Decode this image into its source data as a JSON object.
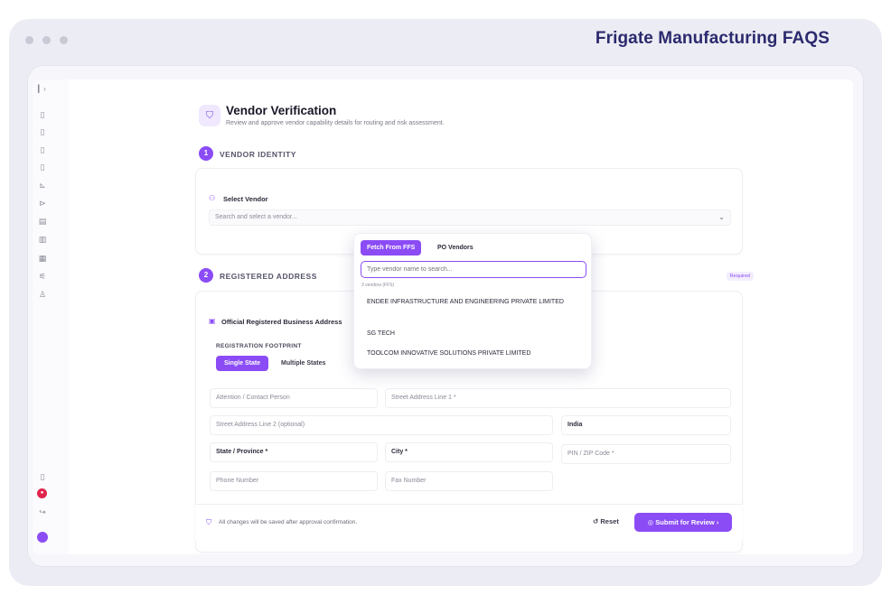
{
  "browser": {
    "brand_title": "Frigate Manufacturing FAQS"
  },
  "header": {
    "title": "Vendor Verification",
    "subtitle": "Review and approve vendor capability details for routing and risk assessment."
  },
  "steps": [
    {
      "number": "1",
      "label": "VENDOR IDENTITY"
    },
    {
      "number": "2",
      "label": "REGISTERED ADDRESS"
    }
  ],
  "vendor_identity": {
    "select_label": "Select Vendor",
    "select_placeholder": "Search and select a vendor..."
  },
  "registered_address": {
    "required_badge": "Required",
    "section_title": "Official Registered Business Address",
    "footprint_label": "REGISTRATION FOOTPRINT",
    "footprint_options": [
      "Single State",
      "Multiple States"
    ],
    "fields": {
      "attention": "Attention / Contact Person",
      "street1": "Street Address Line 1 *",
      "street2": "Street Address Line 2 (optional)",
      "country": "India",
      "state": "State / Province *",
      "city": "City *",
      "pin": "PIN / ZIP Code *",
      "phone": "Phone Number",
      "fax": "Fax Number"
    }
  },
  "footer": {
    "note": "All changes will be saved after approval confirmation.",
    "reset_label": "Reset",
    "submit_label": "Submit for Review"
  },
  "vendor_popover": {
    "tabs": [
      "Fetch From FFS",
      "PO Vendors"
    ],
    "search_placeholder": "Type vendor name to search...",
    "count_text": "3 vendors (FFS)",
    "vendors": [
      "ENDEE INFRASTRUCTURE AND ENGINEERING PRIVATE LIMITED",
      "SG TECH",
      "TOOLCOM INNOVATIVE SOLUTIONS PRIVATE LIMITED"
    ]
  },
  "icons": {
    "header": "shield-check-icon",
    "select_vendor": "users-icon",
    "address": "building-icon",
    "footer_note": "shield-icon",
    "reset": "rotate-ccw-icon",
    "submit": "check-circle-icon",
    "chevron": "chevron-down-icon"
  },
  "colors": {
    "accent": "#8b4cf6",
    "brand_title": "#2b2a6e",
    "notification": "#e0244c"
  }
}
